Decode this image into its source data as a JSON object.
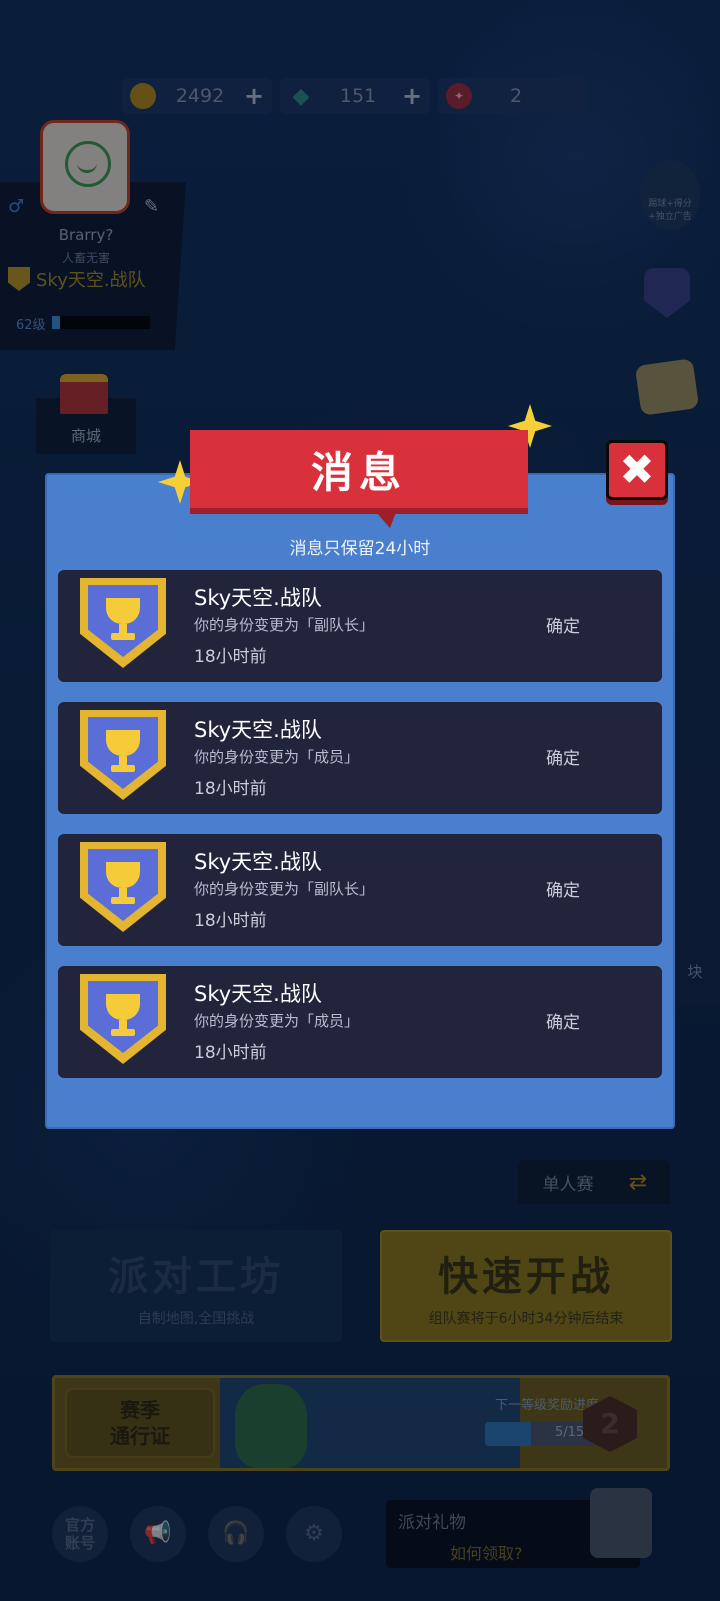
{
  "currency": {
    "coins": "2492",
    "gems": "151",
    "tickets": "2"
  },
  "profile": {
    "name": "Brarry?",
    "subtitle": "人畜无害",
    "team": "Sky天空.战队",
    "level": "62级"
  },
  "sidebar": {
    "shop_label": "商城",
    "event_label": "踢球+得分+独立广告",
    "right_panel_label": "块"
  },
  "modal": {
    "title": "消息",
    "note": "消息只保留24小时",
    "close_glyph": "✖",
    "messages": [
      {
        "team": "Sky天空.战队",
        "body": "你的身份变更为「副队长」",
        "time": "18小时前",
        "action": "确定"
      },
      {
        "team": "Sky天空.战队",
        "body": "你的身份变更为「成员」",
        "time": "18小时前",
        "action": "确定"
      },
      {
        "team": "Sky天空.战队",
        "body": "你的身份变更为「副队长」",
        "time": "18小时前",
        "action": "确定"
      },
      {
        "team": "Sky天空.战队",
        "body": "你的身份变更为「成员」",
        "time": "18小时前",
        "action": "确定"
      }
    ]
  },
  "bottom": {
    "mode_label": "单人赛",
    "workshop_title": "派对工坊",
    "workshop_sub": "自制地图,全国挑战",
    "quickfight_title": "快速开战",
    "quickfight_sub": "组队赛将于6小时34分钟后结束",
    "season_line1": "赛季",
    "season_line2": "通行证",
    "season_next": "下一等级奖励进度",
    "season_progress": "5/15",
    "season_level": "2",
    "official_line1": "官方",
    "official_line2": "账号",
    "gift_title": "派对礼物",
    "gift_sub": "如何领取?"
  },
  "colors": {
    "modal_bg": "#4a7fcd",
    "banner_red": "#d8313c",
    "card_bg": "#22243c",
    "badge_gold": "#e4b531"
  },
  "icons": {
    "coin": "coin-icon",
    "gem": "gem-icon",
    "ticket": "ticket-icon",
    "close": "close-icon",
    "trophy": "trophy-icon",
    "megaphone": "megaphone-icon",
    "headset": "headset-icon",
    "gear": "gear-icon",
    "swap": "swap-icon"
  }
}
